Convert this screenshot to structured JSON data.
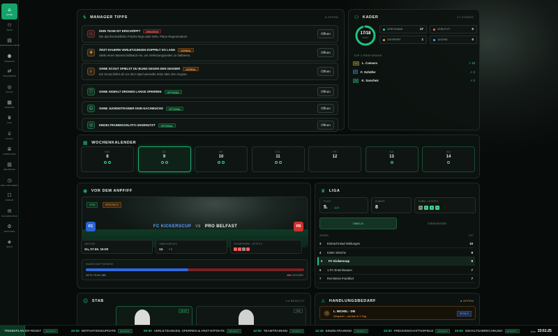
{
  "nav": [
    {
      "label": "Home",
      "icon": "home-icon",
      "glyph": "⌂",
      "active": true
    },
    {
      "label": "Team",
      "icon": "team-icon",
      "glyph": "⚇"
    },
    {
      "label": "Mannschaftsrat",
      "icon": "clipboard-icon",
      "glyph": "▤"
    },
    {
      "label": "Training",
      "icon": "training-icon",
      "glyph": "⚉"
    },
    {
      "label": "Transfers",
      "icon": "transfer-icon",
      "glyph": "⇄"
    },
    {
      "label": "Scout",
      "icon": "scout-icon",
      "glyph": "◎"
    },
    {
      "label": "Stadion",
      "icon": "stadium-icon",
      "glyph": "▦"
    },
    {
      "label": "Liga",
      "icon": "trophy-icon",
      "glyph": "♛"
    },
    {
      "label": "Pokal",
      "icon": "cup-icon",
      "glyph": "♕"
    },
    {
      "label": "Rangliste",
      "icon": "ranking-icon",
      "glyph": "≣"
    },
    {
      "label": "Zentrale",
      "icon": "building-icon",
      "glyph": "▥"
    },
    {
      "label": "Bad Historien",
      "icon": "history-icon",
      "glyph": "◷"
    },
    {
      "label": "Forum",
      "icon": "forum-icon",
      "glyph": "☐"
    },
    {
      "label": "Nachrichten",
      "icon": "mail-icon",
      "glyph": "✉"
    },
    {
      "label": "Settings",
      "icon": "gear-icon",
      "glyph": "⚙"
    },
    {
      "label": "Shop",
      "icon": "shop-icon",
      "glyph": "◈"
    }
  ],
  "tips": {
    "title": "MANAGER TIPPS",
    "count": "6 OFFEN",
    "button": "Öffnen",
    "items": [
      {
        "title": "DEIN TEAM IST ERSCHÖPFT",
        "badge": "DRINGEND",
        "badge_type": "red",
        "text": "Die durchschnittliche Frische liegt unter 50%. Plane Regeneration!",
        "icon": "fire-icon",
        "glyph": "♨",
        "color": "#ff5b5b"
      },
      {
        "title": "ÄRZT DAUERN VERLETZUNGEN DOPPELT SO LANG",
        "badge": "NORMAL",
        "badge_type": "orange",
        "text": "Stelle einen Mannschaftsarzt ein, um Verletzungszeiten zu halbieren.",
        "icon": "medic-icon",
        "glyph": "✚",
        "color": "#f0a04b"
      },
      {
        "title": "OHNE SCOUT SPIELST DU BLIND GEGEN DEN GEGNER",
        "badge": "NORMAL",
        "badge_type": "orange",
        "text": "Ein Scout liefert dir vor dem Spiel wertvolle Infos über den Gegner.",
        "icon": "search-icon",
        "glyph": "⌕",
        "color": "#f0a04b"
      },
      {
        "title": "OHNE ANWALT DROHEN LANGE SPERREN",
        "badge": "OPTIONAL",
        "badge_type": "green",
        "text": "",
        "icon": "shield-icon",
        "glyph": "⛉",
        "color": "#3bd38b"
      },
      {
        "title": "OHNE JUGENDTRAINER KEIN NACHWUCHS",
        "badge": "OPTIONAL",
        "badge_type": "green",
        "text": "",
        "icon": "youth-icon",
        "glyph": "☺",
        "color": "#3bd38b"
      },
      {
        "title": "EINZELTRAININGSSLOTS UNGENUTZT",
        "badge": "OPTIONAL",
        "badge_type": "green",
        "text": "",
        "icon": "target-icon",
        "glyph": "◎",
        "color": "#3bd38b"
      }
    ]
  },
  "kader": {
    "title": "KADER",
    "count": "17 STARKS",
    "ring_value": "17/18",
    "ring_label": "AKTIV",
    "ring_fraction": 0.94,
    "stats": [
      {
        "label": "Verfügbar",
        "value": "17",
        "color": "#3bd38b"
      },
      {
        "label": "Verletzt",
        "value": "0",
        "color": "#ff6b6b"
      },
      {
        "label": "Gesperrt",
        "value": "1",
        "color": "#f0a04b"
      },
      {
        "label": "Jugend",
        "value": "0",
        "color": "#5aa0ff"
      }
    ],
    "top_title": "TOP 3 PERFORMER",
    "top": [
      {
        "pos": "TW",
        "name": "L. Camara",
        "stat": "↗ 15",
        "color": "#e6c84b"
      },
      {
        "pos": "IV",
        "name": "F. Schäfer",
        "stat": "↗ 2",
        "color": "#5aa0ff"
      },
      {
        "pos": "ZM",
        "name": "K. Sanchez",
        "stat": "↗ 2",
        "color": "#3bd38b"
      }
    ]
  },
  "week": {
    "title": "WOCHENKALENDER",
    "days": [
      {
        "name": "MO",
        "date": "8",
        "dots": [
          "#3bd38b",
          "#3bd38b"
        ],
        "state": ""
      },
      {
        "name": "DI",
        "date": "9",
        "dots": [
          "#3bd38b",
          "#3bd38b"
        ],
        "state": "active"
      },
      {
        "name": "MI",
        "date": "10",
        "dots": [
          "#3bd38b",
          "#3bd38b"
        ],
        "state": ""
      },
      {
        "name": "DO",
        "date": "11",
        "dots": [
          "#3bd38b",
          "#3bd38b"
        ],
        "state": ""
      },
      {
        "name": "FR",
        "date": "12",
        "dots": [],
        "state": ""
      },
      {
        "name": "SA",
        "date": "13",
        "dots": [
          "#3bd38b"
        ],
        "state": "hl"
      },
      {
        "name": "SO",
        "date": "14",
        "dots": [
          "#3bd38b"
        ],
        "state": "hl"
      }
    ]
  },
  "match": {
    "title": "VOR DEM ANPFIFF",
    "tag1": "HEIM",
    "tag2": "SPIELTAG 5",
    "home_short": "FC",
    "home": "FC KICKERSCUP",
    "vs": "VS",
    "away": "PRO BELFAST",
    "away_short": "PR",
    "info": [
      {
        "label": "ANSTOSS",
        "value": "So, 07.06. 15:00"
      },
      {
        "label": "TABELLENPLATZ",
        "value": "13.",
        "extra": "• 2"
      },
      {
        "label": "GEGNERFORM · LETZTE 5",
        "value": ""
      }
    ],
    "form": [
      "#ff5b5b",
      "#ff5b5b",
      "#8a8f8c",
      "#ff5b5b"
    ],
    "strength_label": "MANNSCHAFTSSTÄRKE",
    "my_label": "MEIN TEAM",
    "my_value": "135",
    "opp_value": "152",
    "opp_label": "GEGNER",
    "my_fraction": 0.47
  },
  "liga": {
    "title": "LIGA",
    "place_label": "PLATZ",
    "place": "5.",
    "place_badge": "▲ 3",
    "points_label": "PUNKTE",
    "points": "8",
    "form_label": "FORM · LETZTE 5",
    "form": [
      "N",
      "S",
      "S",
      "S"
    ],
    "form_colors": [
      "#8a8f8c",
      "#3bd38b",
      "#3bd38b",
      "#3bd38b"
    ],
    "tab_active": "TABELLE",
    "tab_other": "TORSCHÜTZEN",
    "col_team": "VEREIN",
    "col_pts": "PKT",
    "rows": [
      {
        "pos": "3",
        "team": "Eintracht Bad Wildungen",
        "pts": "10",
        "me": false
      },
      {
        "pos": "4",
        "team": "Kieler Störche",
        "pts": "8",
        "me": false
      },
      {
        "pos": "5",
        "team": "FC Kickerscup",
        "pts": "8",
        "me": true
      },
      {
        "pos": "6",
        "team": "1.FC Entenhausen",
        "pts": "7",
        "me": false
      },
      {
        "pos": "7",
        "team": "Rot-Weiss Frankfurt",
        "pts": "7",
        "me": false
      }
    ]
  },
  "stab": {
    "title": "STAB",
    "count": "1/4 BESETZT",
    "badge1": "AKTIV",
    "badge2": "FREI"
  },
  "need": {
    "title": "HANDLUNGSBEDARF",
    "count": "● OFFEN",
    "item_title": "L. MICHEL · DM",
    "item_text": "Gesperrt – zurück in 1 Tag",
    "item_button": "DETAILS"
  },
  "ticker": [
    {
      "time": "",
      "text": "TRIEBSPLAN",
      "badge": ""
    },
    {
      "time": "",
      "text": "ER-RESET",
      "badge": "ERLEDIGT"
    },
    {
      "time": "22:00",
      "text": "MOTIVATIONSUPDATE",
      "badge": "ERLEDIGT"
    },
    {
      "time": "00:00",
      "text": "VERLETZUNGEN, SPERREN & ARZT-EFFEKTE",
      "badge": "ERLEDIGT"
    },
    {
      "time": "12:00",
      "text": "TEAMTRAINING",
      "badge": "ERLEDIGT"
    },
    {
      "time": "12:45",
      "text": "EINZELTRAINING",
      "badge": "ERLEDIGT"
    },
    {
      "time": "22:00",
      "text": "FREUNDSCHAFTSSPIELE",
      "badge": "ERLEDIGT"
    },
    {
      "time": "23:00",
      "text": "GEHALTSABRECHNUNG",
      "badge": "ERLEDIGT"
    }
  ],
  "clock": "23:51:25"
}
